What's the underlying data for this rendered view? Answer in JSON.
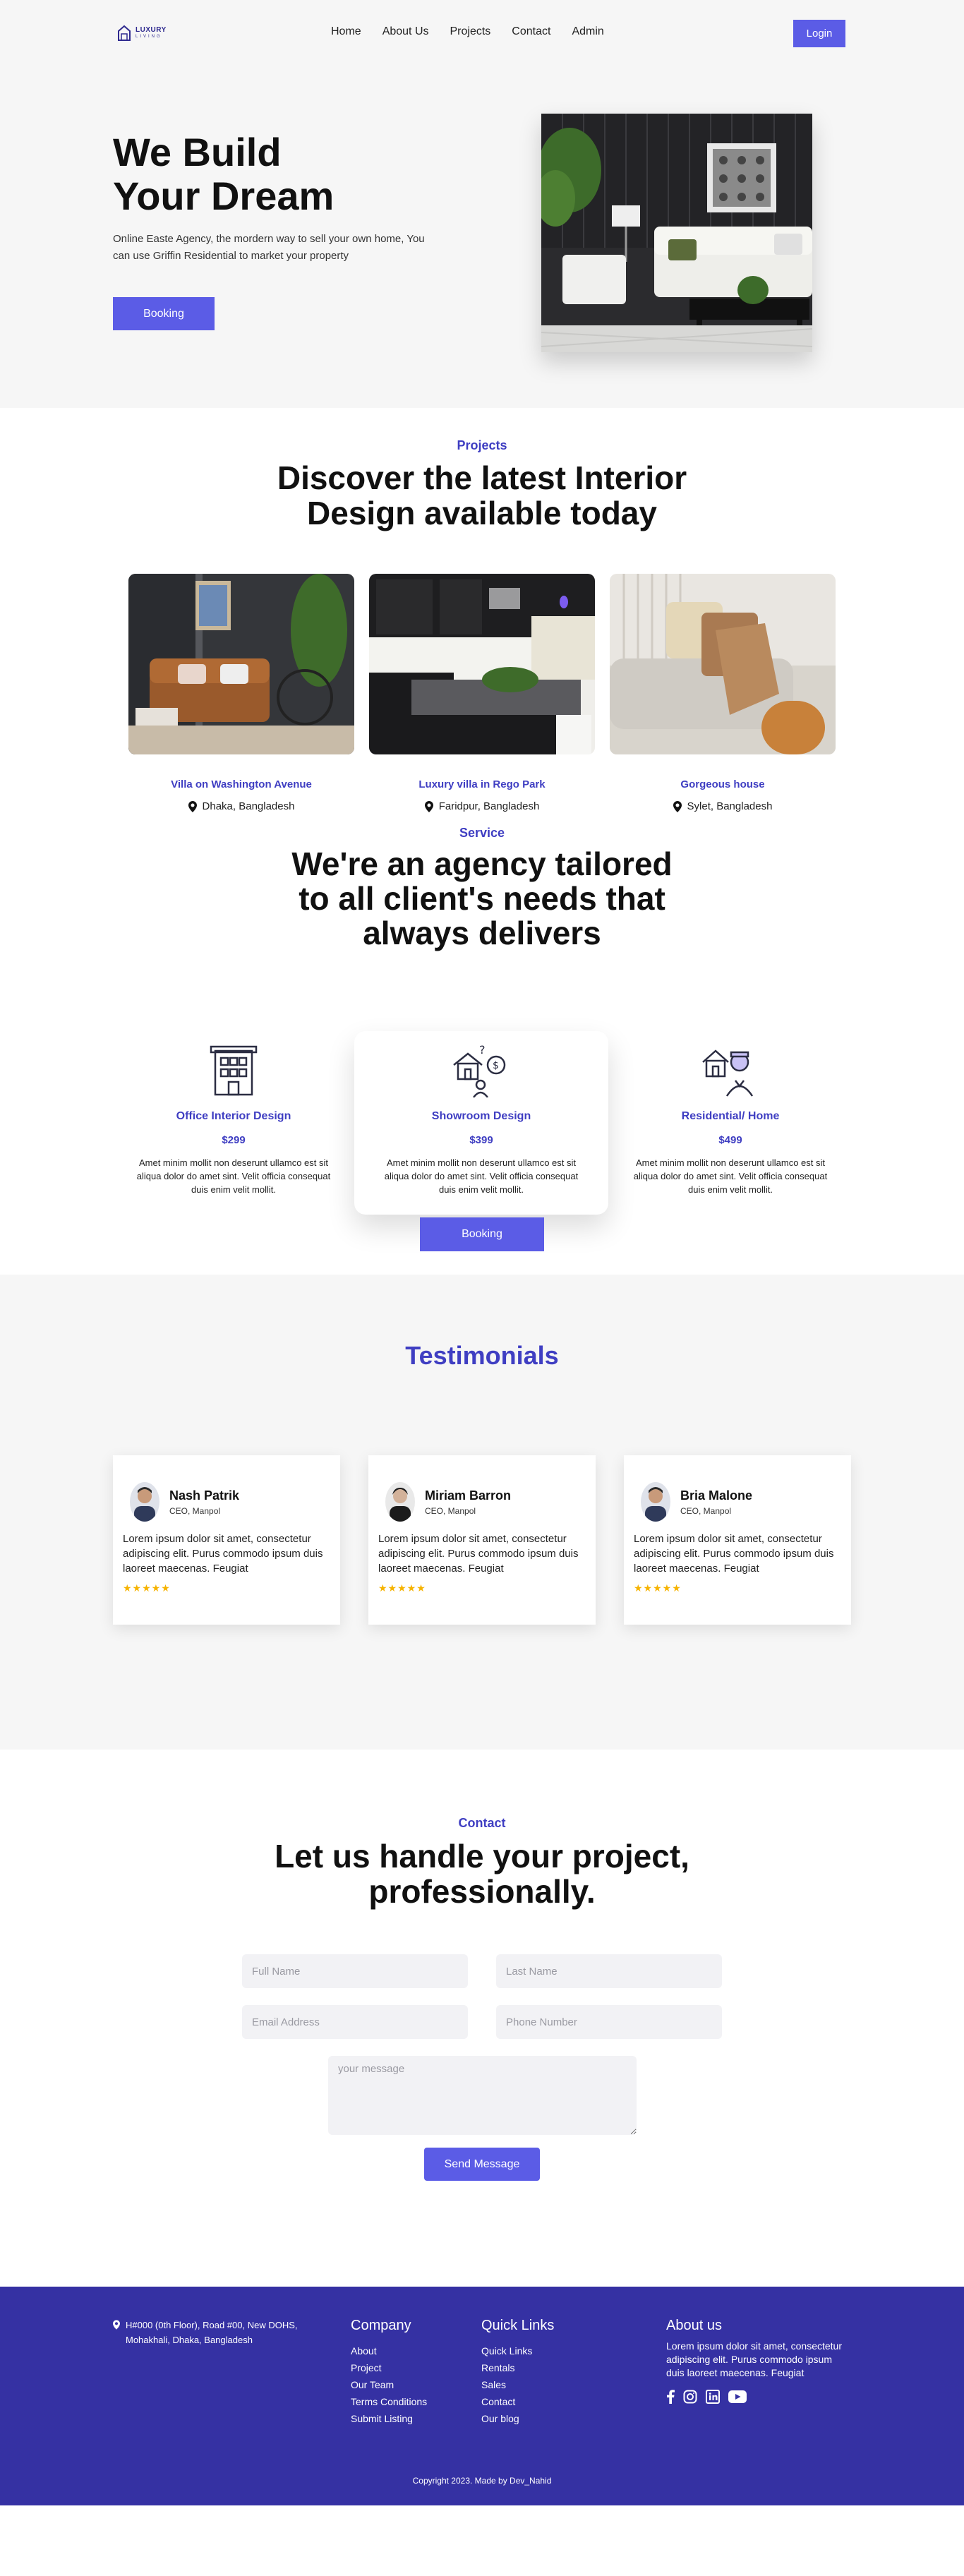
{
  "nav": {
    "logo_top": "LUXURY",
    "logo_bottom": "LIVING",
    "links": [
      "Home",
      "About Us",
      "Projects",
      "Contact",
      "Admin"
    ],
    "login": "Login"
  },
  "hero": {
    "title_line1": "We Build",
    "title_line2": "Your Dream",
    "description": "Online Easte Agency, the mordern way to sell your own home, You can use Griffin Residential to market your property",
    "button": "Booking"
  },
  "projects": {
    "eyebrow": "Projects",
    "title_line1": "Discover the latest Interior",
    "title_line2": "Design available today",
    "items": [
      {
        "name": "Villa on Washington Avenue",
        "location": "Dhaka, Bangladesh"
      },
      {
        "name": "Luxury villa in Rego Park",
        "location": "Faridpur, Bangladesh"
      },
      {
        "name": "Gorgeous house",
        "location": "Sylet, Bangladesh"
      }
    ]
  },
  "service": {
    "eyebrow": "Service",
    "title_line1": "We're an agency tailored",
    "title_line2": "to all client's needs that",
    "title_line3": "always delivers",
    "items": [
      {
        "name": "Office Interior Design",
        "price": "$299",
        "desc": "Amet minim mollit non deserunt ullamco est sit aliqua dolor do amet sint. Velit officia consequat duis enim velit mollit."
      },
      {
        "name": "Showroom Design",
        "price": "$399",
        "desc": "Amet minim mollit non deserunt ullamco est sit aliqua dolor do amet sint. Velit officia consequat duis enim velit mollit."
      },
      {
        "name": "Residential/ Home",
        "price": "$499",
        "desc": "Amet minim mollit non deserunt ullamco est sit aliqua dolor do amet sint. Velit officia consequat duis enim velit mollit."
      }
    ],
    "button": "Booking"
  },
  "testimonials": {
    "title": "Testimonials",
    "items": [
      {
        "name": "Nash Patrik",
        "role": "CEO, Manpol",
        "text": "Lorem ipsum dolor sit amet, consectetur adipiscing elit. Purus commodo ipsum duis laoreet maecenas. Feugiat",
        "stars": "★★★★★"
      },
      {
        "name": "Miriam Barron",
        "role": "CEO, Manpol",
        "text": "Lorem ipsum dolor sit amet, consectetur adipiscing elit. Purus commodo ipsum duis laoreet maecenas. Feugiat",
        "stars": "★★★★★"
      },
      {
        "name": "Bria Malone",
        "role": "CEO, Manpol",
        "text": "Lorem ipsum dolor sit amet, consectetur adipiscing elit. Purus commodo ipsum duis laoreet maecenas. Feugiat",
        "stars": "★★★★★"
      }
    ]
  },
  "contact": {
    "eyebrow": "Contact",
    "title_line1": "Let us handle your project,",
    "title_line2": "professionally.",
    "full_name_placeholder": "Full Name",
    "last_name_placeholder": "Last Name",
    "email_placeholder": "Email Address",
    "phone_placeholder": "Phone Number",
    "message_placeholder": "your message",
    "button": "Send Message"
  },
  "footer": {
    "address": "H#000 (0th Floor), Road #00, New DOHS, Mohakhali, Dhaka, Bangladesh",
    "company_title": "Company",
    "company_links": [
      "About",
      "Project",
      "Our Team",
      "Terms Conditions",
      "Submit Listing"
    ],
    "quick_title": "Quick Links",
    "quick_links": [
      "Quick Links",
      "Rentals",
      "Sales",
      "Contact",
      "Our blog"
    ],
    "about_title": "About us",
    "about_text": "Lorem ipsum dolor sit amet, consectetur adipiscing elit. Purus commodo ipsum duis laoreet maecenas. Feugiat",
    "copyright": "Copyright 2023. Made by Dev_Nahid"
  },
  "colors": {
    "brand": "#5b5ce6",
    "accent_text": "#3f3ec2",
    "footer_bg": "#3531a3"
  }
}
